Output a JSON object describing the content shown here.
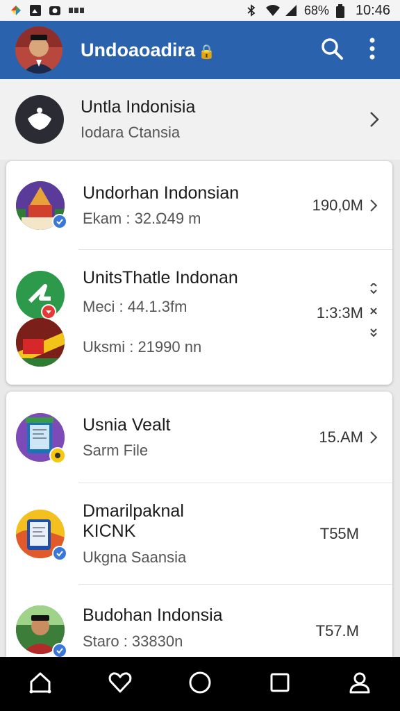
{
  "status_bar": {
    "time": "10:46",
    "battery": "68%"
  },
  "app_bar": {
    "title": "Undoaoadira",
    "title_suffix": "🔒"
  },
  "top_item": {
    "title": "Untla Indonisia",
    "subtitle": "Iodara Ctansia"
  },
  "card1": {
    "rows": [
      {
        "title": "Undorhan Indonsian",
        "subtitle": "Ekam : 32.Ω49 m",
        "size": "190,0M"
      },
      {
        "title": "UnitsThatle Indonan",
        "subtitle": "Meci : 44.1.3fm",
        "size": "1:3:3M",
        "subtitle2": "Uksmi : 21990 nn"
      }
    ]
  },
  "card2": {
    "rows": [
      {
        "title": "Usnia Vealt",
        "subtitle": "Sarm File",
        "size": "15.AM"
      },
      {
        "title": "Dmarilpaknal",
        "title2": "KICNK",
        "subtitle": "Ukgna Saansia",
        "size": "T55M"
      },
      {
        "title": "Budohan Indonsia",
        "subtitle": "Staro : 33830n",
        "size": "T57.M"
      }
    ]
  },
  "colors": {
    "app_bar": "#2a62ad",
    "accent_blue": "#3a78d8",
    "nav_bg": "#000000"
  }
}
